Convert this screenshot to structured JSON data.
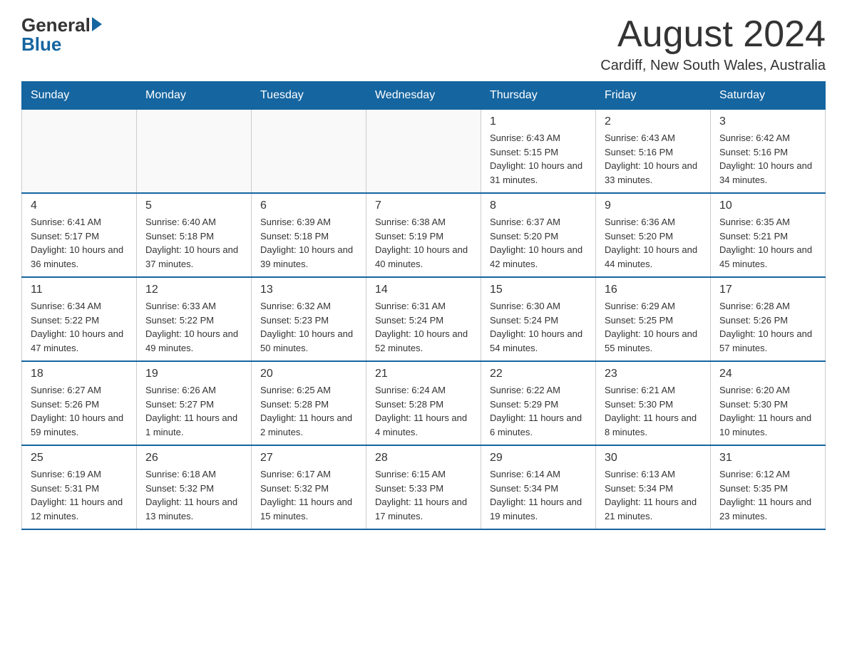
{
  "header": {
    "logo_general": "General",
    "logo_blue": "Blue",
    "month_title": "August 2024",
    "location": "Cardiff, New South Wales, Australia"
  },
  "days_of_week": [
    "Sunday",
    "Monday",
    "Tuesday",
    "Wednesday",
    "Thursday",
    "Friday",
    "Saturday"
  ],
  "weeks": [
    [
      {
        "day": "",
        "info": ""
      },
      {
        "day": "",
        "info": ""
      },
      {
        "day": "",
        "info": ""
      },
      {
        "day": "",
        "info": ""
      },
      {
        "day": "1",
        "info": "Sunrise: 6:43 AM\nSunset: 5:15 PM\nDaylight: 10 hours and 31 minutes."
      },
      {
        "day": "2",
        "info": "Sunrise: 6:43 AM\nSunset: 5:16 PM\nDaylight: 10 hours and 33 minutes."
      },
      {
        "day": "3",
        "info": "Sunrise: 6:42 AM\nSunset: 5:16 PM\nDaylight: 10 hours and 34 minutes."
      }
    ],
    [
      {
        "day": "4",
        "info": "Sunrise: 6:41 AM\nSunset: 5:17 PM\nDaylight: 10 hours and 36 minutes."
      },
      {
        "day": "5",
        "info": "Sunrise: 6:40 AM\nSunset: 5:18 PM\nDaylight: 10 hours and 37 minutes."
      },
      {
        "day": "6",
        "info": "Sunrise: 6:39 AM\nSunset: 5:18 PM\nDaylight: 10 hours and 39 minutes."
      },
      {
        "day": "7",
        "info": "Sunrise: 6:38 AM\nSunset: 5:19 PM\nDaylight: 10 hours and 40 minutes."
      },
      {
        "day": "8",
        "info": "Sunrise: 6:37 AM\nSunset: 5:20 PM\nDaylight: 10 hours and 42 minutes."
      },
      {
        "day": "9",
        "info": "Sunrise: 6:36 AM\nSunset: 5:20 PM\nDaylight: 10 hours and 44 minutes."
      },
      {
        "day": "10",
        "info": "Sunrise: 6:35 AM\nSunset: 5:21 PM\nDaylight: 10 hours and 45 minutes."
      }
    ],
    [
      {
        "day": "11",
        "info": "Sunrise: 6:34 AM\nSunset: 5:22 PM\nDaylight: 10 hours and 47 minutes."
      },
      {
        "day": "12",
        "info": "Sunrise: 6:33 AM\nSunset: 5:22 PM\nDaylight: 10 hours and 49 minutes."
      },
      {
        "day": "13",
        "info": "Sunrise: 6:32 AM\nSunset: 5:23 PM\nDaylight: 10 hours and 50 minutes."
      },
      {
        "day": "14",
        "info": "Sunrise: 6:31 AM\nSunset: 5:24 PM\nDaylight: 10 hours and 52 minutes."
      },
      {
        "day": "15",
        "info": "Sunrise: 6:30 AM\nSunset: 5:24 PM\nDaylight: 10 hours and 54 minutes."
      },
      {
        "day": "16",
        "info": "Sunrise: 6:29 AM\nSunset: 5:25 PM\nDaylight: 10 hours and 55 minutes."
      },
      {
        "day": "17",
        "info": "Sunrise: 6:28 AM\nSunset: 5:26 PM\nDaylight: 10 hours and 57 minutes."
      }
    ],
    [
      {
        "day": "18",
        "info": "Sunrise: 6:27 AM\nSunset: 5:26 PM\nDaylight: 10 hours and 59 minutes."
      },
      {
        "day": "19",
        "info": "Sunrise: 6:26 AM\nSunset: 5:27 PM\nDaylight: 11 hours and 1 minute."
      },
      {
        "day": "20",
        "info": "Sunrise: 6:25 AM\nSunset: 5:28 PM\nDaylight: 11 hours and 2 minutes."
      },
      {
        "day": "21",
        "info": "Sunrise: 6:24 AM\nSunset: 5:28 PM\nDaylight: 11 hours and 4 minutes."
      },
      {
        "day": "22",
        "info": "Sunrise: 6:22 AM\nSunset: 5:29 PM\nDaylight: 11 hours and 6 minutes."
      },
      {
        "day": "23",
        "info": "Sunrise: 6:21 AM\nSunset: 5:30 PM\nDaylight: 11 hours and 8 minutes."
      },
      {
        "day": "24",
        "info": "Sunrise: 6:20 AM\nSunset: 5:30 PM\nDaylight: 11 hours and 10 minutes."
      }
    ],
    [
      {
        "day": "25",
        "info": "Sunrise: 6:19 AM\nSunset: 5:31 PM\nDaylight: 11 hours and 12 minutes."
      },
      {
        "day": "26",
        "info": "Sunrise: 6:18 AM\nSunset: 5:32 PM\nDaylight: 11 hours and 13 minutes."
      },
      {
        "day": "27",
        "info": "Sunrise: 6:17 AM\nSunset: 5:32 PM\nDaylight: 11 hours and 15 minutes."
      },
      {
        "day": "28",
        "info": "Sunrise: 6:15 AM\nSunset: 5:33 PM\nDaylight: 11 hours and 17 minutes."
      },
      {
        "day": "29",
        "info": "Sunrise: 6:14 AM\nSunset: 5:34 PM\nDaylight: 11 hours and 19 minutes."
      },
      {
        "day": "30",
        "info": "Sunrise: 6:13 AM\nSunset: 5:34 PM\nDaylight: 11 hours and 21 minutes."
      },
      {
        "day": "31",
        "info": "Sunrise: 6:12 AM\nSunset: 5:35 PM\nDaylight: 11 hours and 23 minutes."
      }
    ]
  ]
}
